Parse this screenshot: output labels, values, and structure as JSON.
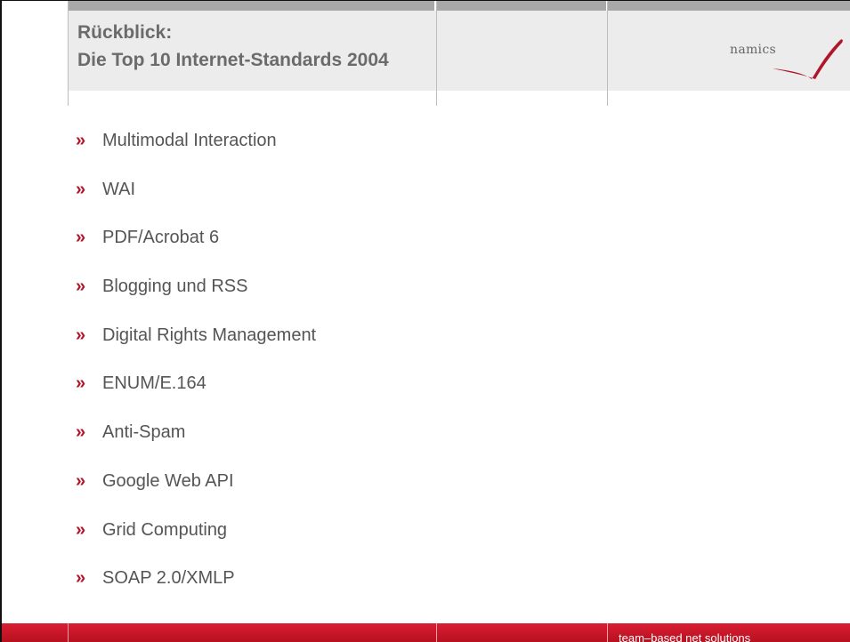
{
  "slide": {
    "title_line1": "Rückblick:",
    "title_line2": "Die Top 10 Internet-Standards 2004",
    "logo_text": "namics",
    "bullet_symbol": "»",
    "items": [
      "Multimodal Interaction",
      "WAI",
      "PDF/Acrobat 6",
      "Blogging und RSS",
      "Digital Rights Management",
      "ENUM/E.164",
      "Anti-Spam",
      "Google Web API",
      "Grid Computing",
      "SOAP 2.0/XMLP"
    ],
    "footer_text": "team–based net solutions"
  },
  "colors": {
    "accent_red": "#b0152a",
    "title_gray": "#6b6b6b",
    "header_band": "#ececec",
    "footer_red": "#d91e32"
  },
  "icons": {
    "logo_mark": "namics-swoosh-icon"
  }
}
